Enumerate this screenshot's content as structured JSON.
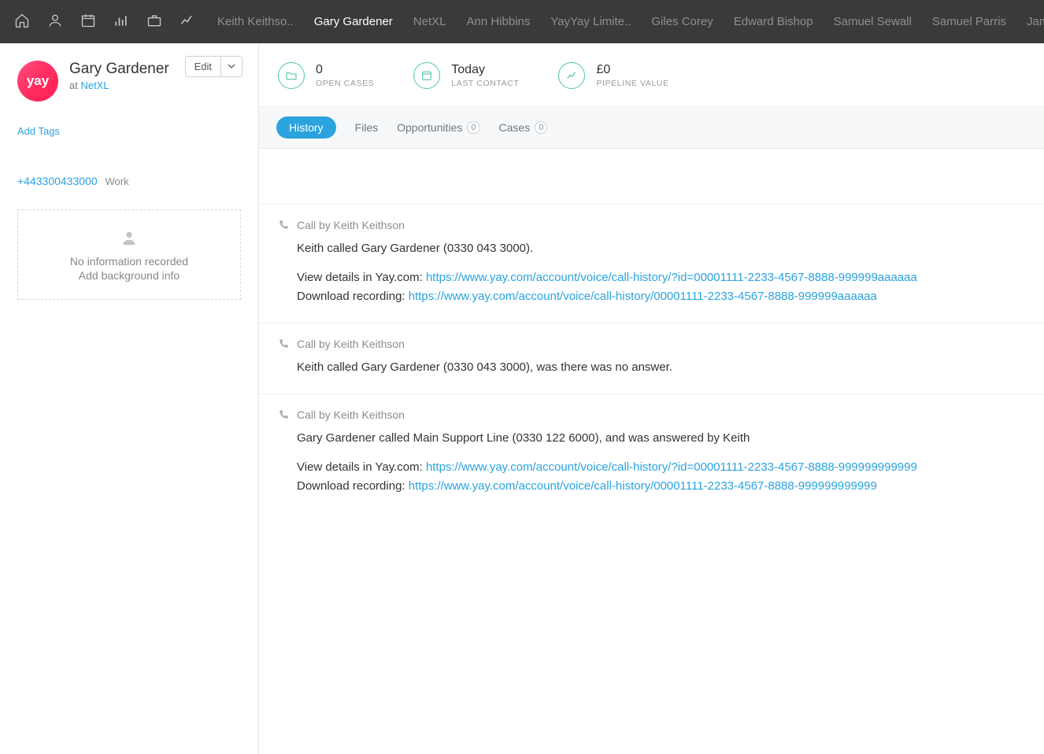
{
  "topbar": {
    "tabs": [
      "Keith Keithso..",
      "Gary Gardener",
      "NetXL",
      "Ann Hibbins",
      "YayYay Limite..",
      "Giles Corey",
      "Edward Bishop",
      "Samuel Sewall",
      "Samuel Parris",
      "James Bayley"
    ],
    "active_index": 1
  },
  "sidebar": {
    "avatar_text": "yay",
    "name": "Gary Gardener",
    "at_prefix": "at ",
    "company": "NetXL",
    "edit_label": "Edit",
    "add_tags": "Add Tags",
    "phone": "+443300433000",
    "phone_type": "Work",
    "bg_line1": "No information recorded",
    "bg_line2": "Add background info"
  },
  "stats": {
    "open_cases_value": "0",
    "open_cases_label": "OPEN CASES",
    "last_contact_value": "Today",
    "last_contact_label": "LAST CONTACT",
    "pipeline_value": "£0",
    "pipeline_label": "PIPELINE VALUE"
  },
  "tabs": {
    "history": "History",
    "files": "Files",
    "opportunities": "Opportunities",
    "opportunities_count": "0",
    "cases": "Cases",
    "cases_count": "0"
  },
  "feed": [
    {
      "header": "Call by Keith Keithson",
      "line1": "Keith called Gary Gardener (0330 043 3000).",
      "details_prefix": "View details in Yay.com: ",
      "details_url": "https://www.yay.com/account/voice/call-history/?id=00001111-2233-4567-8888-999999aaaaaa",
      "download_prefix": "Download recording: ",
      "download_url": "https://www.yay.com/account/voice/call-history/00001111-2233-4567-8888-999999aaaaaa"
    },
    {
      "header": "Call by Keith Keithson",
      "line1": "Keith called Gary Gardener (0330 043 3000), was there was no answer."
    },
    {
      "header": "Call by Keith Keithson",
      "line1": "Gary Gardener called Main Support Line (0330 122 6000), and was answered by Keith",
      "details_prefix": "View details in Yay.com: ",
      "details_url": "https://www.yay.com/account/voice/call-history/?id=00001111-2233-4567-8888-999999999999",
      "download_prefix": "Download recording: ",
      "download_url": "https://www.yay.com/account/voice/call-history/00001111-2233-4567-8888-999999999999"
    }
  ]
}
